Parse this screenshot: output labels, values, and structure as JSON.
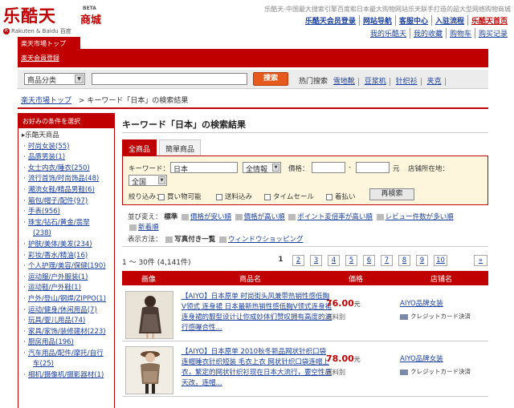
{
  "header": {
    "logo_main": "乐酷天",
    "logo_mall": "商城",
    "logo_beta": "BETA",
    "logo_sub": "Rakuten & Baidu 百度",
    "tagline": "乐酷天-中国最大搜索引擎百度和日本最大购物网站乐天联手打造的超大型网络购物商城",
    "nav": [
      "乐酷天会员登录",
      "网站导航",
      "客服中心",
      "入驻流程",
      "乐酷天首页"
    ],
    "subnav": [
      "我的乐酷天",
      "我的收藏",
      "购物车",
      "购买记录"
    ]
  },
  "tabbar": {
    "tab": "楽天市場トップ",
    "link": "楽天会員登録"
  },
  "search": {
    "category": "商品分类",
    "query": "",
    "button": "搜索",
    "hot_label": "热门搜索",
    "hot": [
      "雪地靴",
      "豆浆机",
      "针织衫",
      "夹克"
    ]
  },
  "breadcrumb": {
    "root": "楽天市場トップ",
    "current": "キーワード「日本」の検索結果"
  },
  "sidebar": {
    "header": "お好みの条件を選択",
    "root": "乐酷天商品",
    "items": [
      "时尚女装(55)",
      "品质男装(1)",
      "女士内衣/睡衣(250)",
      "流行首饰/时尚饰品(48)",
      "潮流女鞋/精品男鞋(6)",
      "箱包/帽子/配件(97)",
      "手表(956)",
      "珠宝/钻石/黄金/翡翠",
      "(238)",
      "护肤/美体/美发(234)",
      "彩妆/香水/精油(16)",
      "个人护理/美容/保健(190)",
      "运动服/户外服装(1)",
      "运动鞋/户外鞋(1)",
      "户外/登山/钢焊/ZIPPO(1)",
      "运动/健身/休闲用品(7)",
      "玩具/婴儿用品(74)",
      "家具/家饰/装修建材(223)",
      "厨房用品(196)",
      "汽车用品/配件/摩托/自行",
      "车(25)",
      "相机/摄像机/摄影器材(1)"
    ]
  },
  "main": {
    "title": "キーワード「日本」の検索結果",
    "tabs": [
      "全商品",
      "簡單商品"
    ],
    "filter": {
      "keyword_label": "キーワード：",
      "keyword": "日本",
      "scope": "全情報",
      "price_label": "價格：",
      "price_min": "",
      "price_max": "",
      "price_unit": "元",
      "store_loc_label": "店铺所在地：",
      "store_loc": "全国",
      "narrow_label": "絞り込み：",
      "checks": [
        "買い物可能",
        "送料込み",
        "タイムセール",
        "着払い"
      ],
      "research_button": "再検索"
    },
    "sort": {
      "label": "並び変え：",
      "options": [
        "標準",
        "價格が安い順",
        "價格が高い順",
        "ポイント変倍率が高い順",
        "レビュー件数が多い順",
        "新着順"
      ],
      "display_label": "表示方法：",
      "display_options": [
        "写真付き一覧",
        "ウィンドウショッピング"
      ]
    },
    "pager": {
      "count": "1 ～ 30件 (4,141件)",
      "current": "1",
      "pages": [
        "2",
        "3",
        "4",
        "5",
        "6",
        "7",
        "8",
        "9",
        "10"
      ],
      "next": "»"
    },
    "table_headers": [
      "画像",
      "商品名",
      "価格",
      "店铺名"
    ],
    "rows": [
      {
        "name": "【AIYO】日本原单 时尚街头风兼带热销性感低胸V领式 连身裙 日本最新热销性感低胸V领式连身裙连身裙的靓型设计让你成妙体们赞叹拥有高度的流行感曝合性...",
        "price": "76.00",
        "unit": "元",
        "ship": "送料別",
        "shop": "AIYO品牌女装",
        "card": "クレジットカード決済"
      },
      {
        "name": "【AIYO】日本原单 2010秋冬新品网状针织口袋连帽睡衣针织短装 毛衣上衣 网状针织口袋连帽上衣，繁定的网状针织衫现在日本大流行，要空性质天改，连帽...",
        "price": "78.00",
        "unit": "元",
        "ship": "送料別",
        "shop": "AIYO品牌女装",
        "card": "クレジットカード決済"
      }
    ]
  }
}
